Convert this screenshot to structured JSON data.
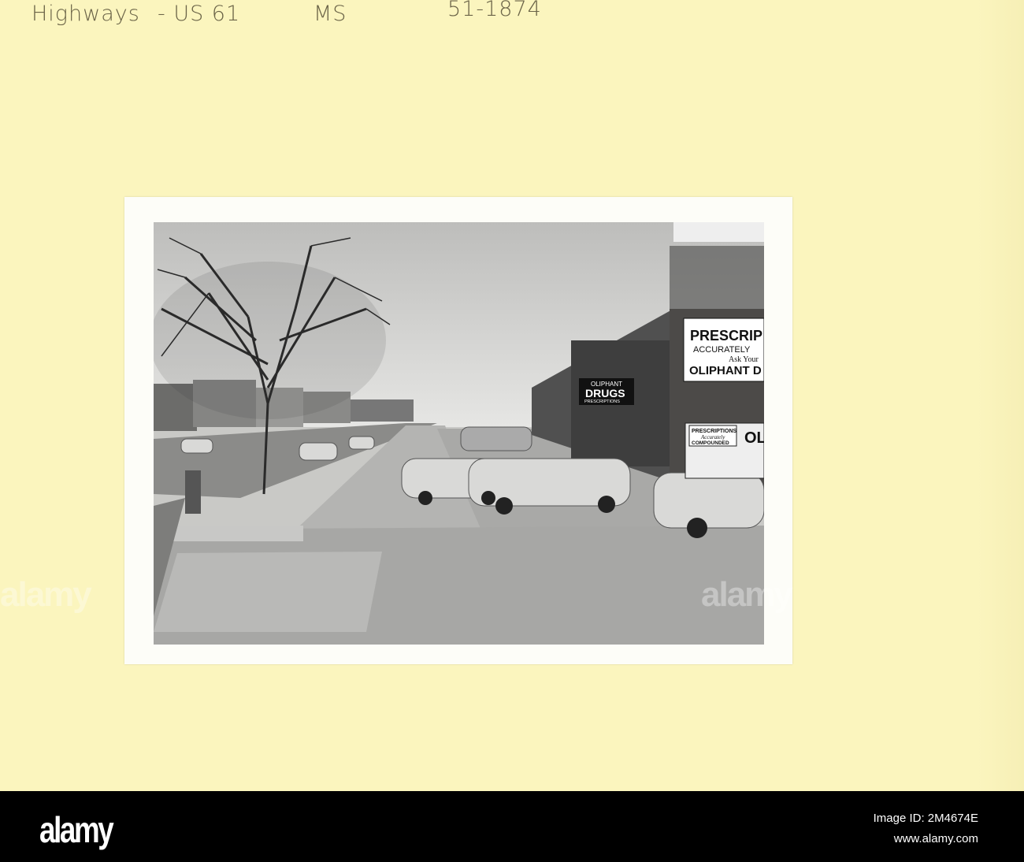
{
  "annotations": {
    "subject": "Highways",
    "route": "- US 61",
    "state": "MS",
    "number": "51-1874"
  },
  "signs": {
    "big_sign_line1": "PRESCRIP",
    "big_sign_line2": "ACCURATELY",
    "big_sign_line3": "Ask Your",
    "big_sign_line4": "OLIPHANT D",
    "drug_sign_line1": "OLIPHANT",
    "drug_sign_line2": "DRUGS",
    "drug_sign_line3": "PRESCRIPTIONS",
    "window_sign_line1": "PRESCRIPTIONS",
    "window_sign_line2": "Accurately",
    "window_sign_line3": "COMPOUNDED",
    "window_sign_line4": "OL"
  },
  "watermark": "alamy",
  "footer": {
    "logo": "alamy",
    "image_id": "Image ID: 2M4674E",
    "url": "www.alamy.com"
  },
  "colors": {
    "card": "#fbf5be",
    "footer": "#000000"
  }
}
